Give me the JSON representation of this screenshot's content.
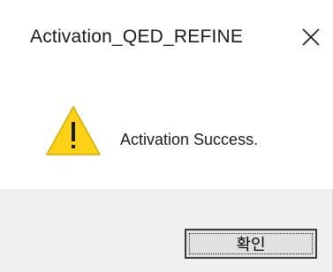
{
  "dialog": {
    "title": "Activation_QED_REFINE",
    "message": "Activation Success.",
    "ok_label": "확인",
    "icons": {
      "close": "close-icon",
      "warning": "warning-icon"
    },
    "colors": {
      "warning_fill": "#fcd116",
      "footer_bg": "#f0f0f0",
      "button_bg": "#e1e1e1"
    }
  }
}
